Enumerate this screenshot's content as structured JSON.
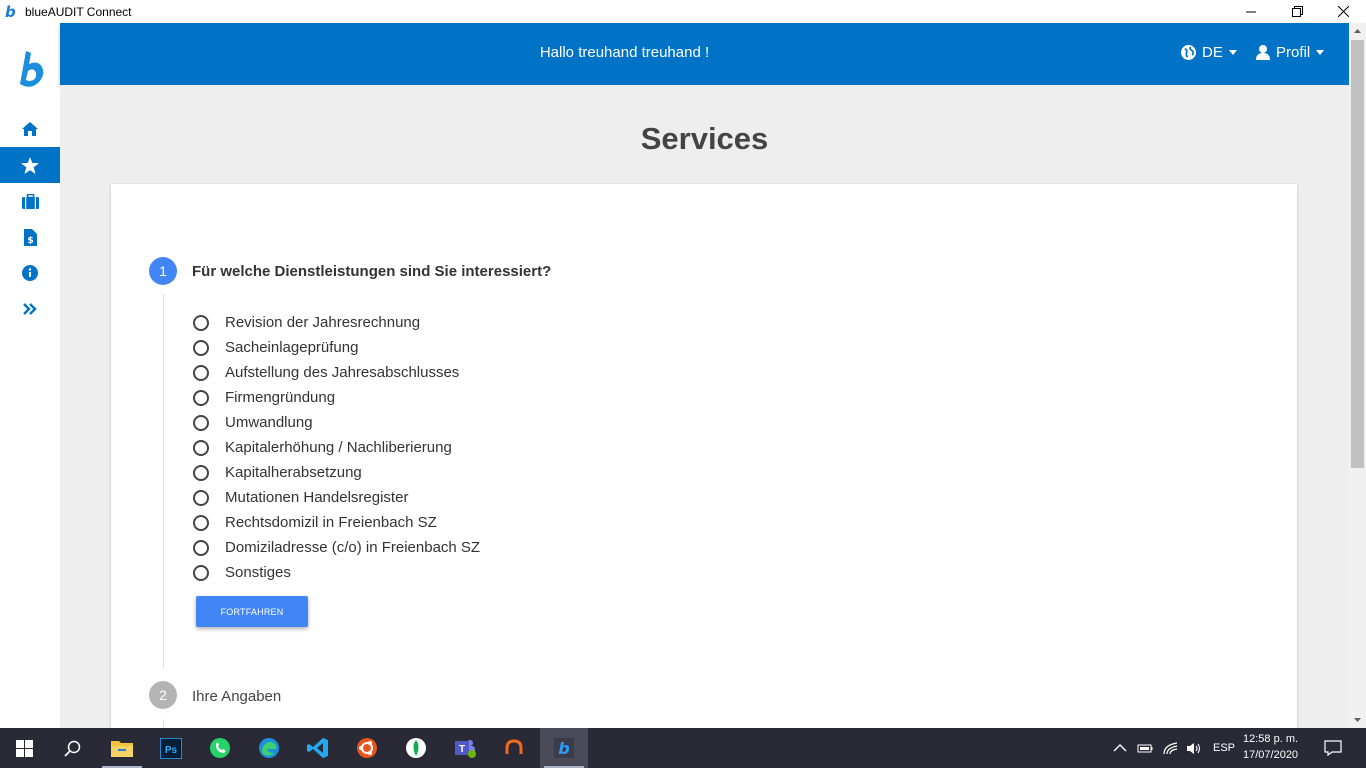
{
  "window": {
    "title": "blueAUDIT Connect"
  },
  "header": {
    "greeting": "Hallo treuhand treuhand !",
    "language": "DE",
    "profile": "Profil"
  },
  "sidebar": {
    "items": [
      {
        "name": "home",
        "icon": "home-icon"
      },
      {
        "name": "services",
        "icon": "star-icon",
        "active": true
      },
      {
        "name": "cases",
        "icon": "briefcase-icon"
      },
      {
        "name": "invoices",
        "icon": "invoice-icon"
      },
      {
        "name": "info",
        "icon": "info-icon"
      },
      {
        "name": "expand",
        "icon": "double-chevron-right-icon"
      }
    ]
  },
  "page": {
    "title": "Services"
  },
  "stepper": {
    "step1": {
      "number": "1",
      "title": "Für welche Dienstleistungen sind Sie interessiert?",
      "options": [
        "Revision der Jahresrechnung",
        "Sacheinlageprüfung",
        "Aufstellung des Jahresabschlusses",
        "Firmengründung",
        "Umwandlung",
        "Kapitalerhöhung / Nachliberierung",
        "Kapitalherabsetzung",
        "Mutationen Handelsregister",
        "Rechtsdomizil in Freienbach SZ",
        "Domiziladresse (c/o) in Freienbach SZ",
        "Sonstiges"
      ],
      "button": "FORTFAHREN"
    },
    "step2": {
      "number": "2",
      "title": "Ihre Angaben"
    }
  },
  "taskbar": {
    "language": "ESP",
    "time": "12:58 p. m.",
    "date": "17/07/2020"
  },
  "colors": {
    "brand": "#0073c6",
    "accent": "#4285f4",
    "taskbar": "#2a2936"
  }
}
